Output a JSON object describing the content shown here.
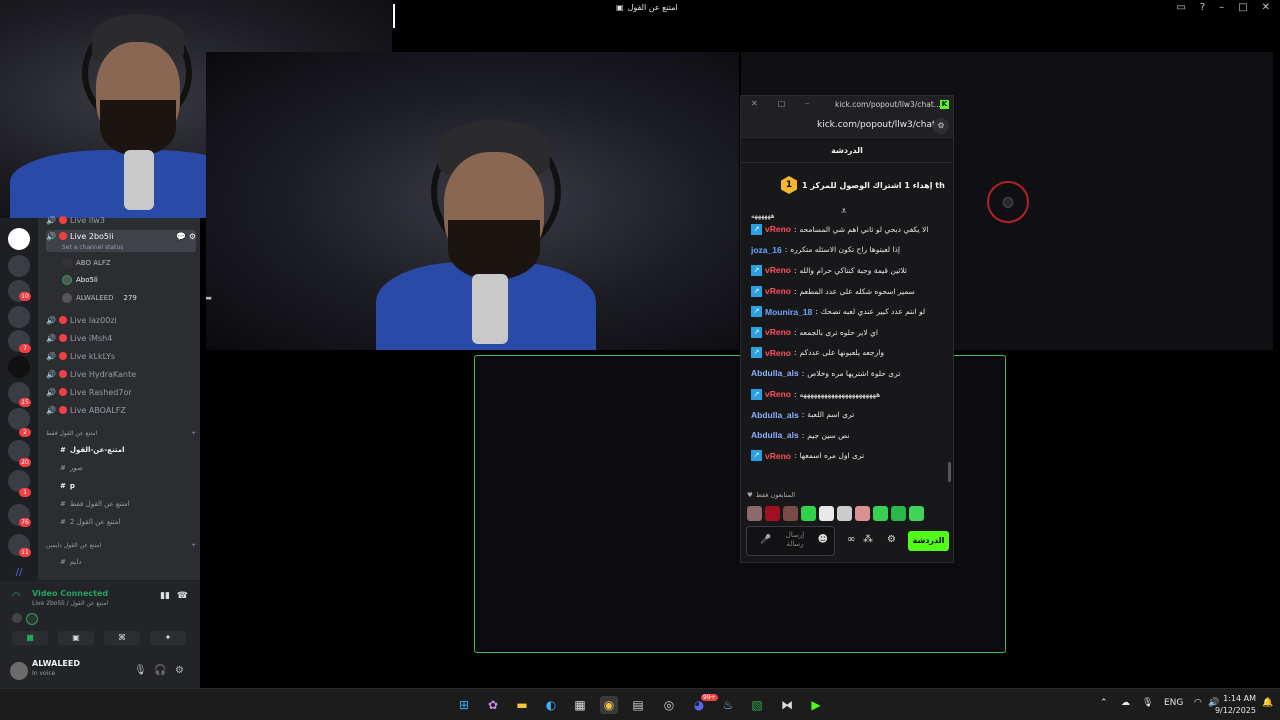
{
  "window": {
    "title": "امتنع عن القول"
  },
  "discord": {
    "channels": [
      {
        "label": "Live llw3",
        "top": 0
      },
      {
        "label": "Live 2bo5li",
        "sub": "Set a channel status",
        "active": true
      },
      {
        "label": "Live laz00zi"
      },
      {
        "label": "Live iMsh4"
      },
      {
        "label": "Live kLkLYs"
      },
      {
        "label": "Live HydraKante"
      },
      {
        "label": "Live Rashed7or"
      },
      {
        "label": "Live ABOALFZ"
      }
    ],
    "members": [
      {
        "name": "ABO ALFZ"
      },
      {
        "name": "Abo5li"
      },
      {
        "name": "ALWALEED",
        "extra": "279"
      }
    ],
    "category1": "امتنع عن القول فقط",
    "text_channels": [
      {
        "name": "امتنع-عن-القول",
        "bold": true
      },
      {
        "name": "صور"
      },
      {
        "name": "p",
        "bold": true
      },
      {
        "name": "امتنع عن القول فقط"
      },
      {
        "name": "امتنع عن القول 2"
      }
    ],
    "category2": "امتنع عن القول دايمين",
    "text_channels2": [
      {
        "name": "دايم"
      }
    ],
    "server_badges": [
      "10",
      "7",
      "15",
      "2",
      "20",
      "1",
      "76",
      "11"
    ],
    "voice": {
      "status": "Video Connected",
      "channel": "Live 2bo5li / امتنع عن القول"
    },
    "user": {
      "name": "ALWALEED",
      "status": "In voice"
    }
  },
  "kick": {
    "window_url": "kick.com/popout/llw3/chat...",
    "url": "kick.com/popout/llw3/chat",
    "chat_title": "الدردشة",
    "pinned": "إهداء 1 اشتراك الوصول للمركز 1 th",
    "pinned_rank": "1",
    "first_line": "ههههههه",
    "messages": [
      {
        "user": "vReno",
        "color": "#ff4d5e",
        "badge": true,
        "text": "الا يكفي دبحي لو ثاني اهم شي المسامحه"
      },
      {
        "user": "joza_16",
        "color": "#6aa6ff",
        "badge": false,
        "text": "إذا لعبتوها راح تكون الاسئله متكرره"
      },
      {
        "user": "vReno",
        "color": "#ff4d5e",
        "badge": true,
        "text": "ثلاثين قيمة وجبة كنتاكي حرام والله"
      },
      {
        "user": "vReno",
        "color": "#ff4d5e",
        "badge": true,
        "text": "سمير اسحوه شكله على عدد المطعم"
      },
      {
        "user": "Mounira_18",
        "color": "#6aa6ff",
        "badge": true,
        "text": "لو انتم عدد كبير عندي لعبه تضحك"
      },
      {
        "user": "vReno",
        "color": "#ff4d5e",
        "badge": true,
        "text": "اي لاير حلوه ترى بالجمعه"
      },
      {
        "user": "vReno",
        "color": "#ff4d5e",
        "badge": true,
        "text": "وارجعه يلعبونها على عددكم"
      },
      {
        "user": "Abdulla_als",
        "color": "#8ab4ff",
        "badge": false,
        "text": "ترى حلوة اشتريها مره وخلاص"
      },
      {
        "user": "vReno",
        "color": "#ff4d5e",
        "badge": true,
        "text": "ههههههههههههههههههههههه"
      },
      {
        "user": "Abdulla_als",
        "color": "#8ab4ff",
        "badge": false,
        "text": "ترى اسم اللعبة"
      },
      {
        "user": "Abdulla_als",
        "color": "#8ab4ff",
        "badge": false,
        "text": "نص سين جيم"
      },
      {
        "user": "vReno",
        "color": "#ff4d5e",
        "badge": true,
        "text": "ترى اول مره اسمعها"
      }
    ],
    "subs_only": "المتابعون فقط",
    "input_placeholder": "إرسال رسالة",
    "send_label": "الدردشة"
  },
  "taskbar": {
    "lang": "ENG",
    "time": "1:14 AM",
    "date": "9/12/2025",
    "notif_badge": "99+"
  }
}
